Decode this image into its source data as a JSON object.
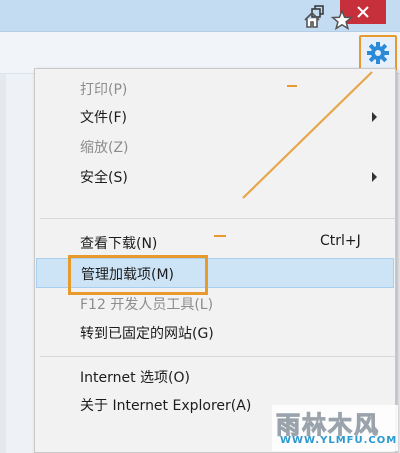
{
  "window": {
    "restore_icon": "restore-icon",
    "close_icon": "close-icon",
    "close_color": "#c7303a"
  },
  "toolbar": {
    "icons": [
      "home-icon",
      "star-icon",
      "gear-icon"
    ],
    "gear_color": "#2a8ad8",
    "highlight_color": "#e89a2c"
  },
  "menu": {
    "items": [
      {
        "label": "打印(P)",
        "enabled": false,
        "submenu": false
      },
      {
        "label": "文件(F)",
        "enabled": true,
        "submenu": true
      },
      {
        "label": "缩放(Z)",
        "enabled": false,
        "submenu": false
      },
      {
        "label": "安全(S)",
        "enabled": true,
        "submenu": true
      },
      {
        "label": "查看下载(N)",
        "enabled": true,
        "shortcut": "Ctrl+J"
      },
      {
        "label": "管理加载项(M)",
        "enabled": true,
        "highlighted": true
      },
      {
        "label": "F12 开发人员工具(L)",
        "enabled": false
      },
      {
        "label": "转到已固定的网站(G)",
        "enabled": true
      },
      {
        "label": "Internet 选项(O)",
        "enabled": true
      },
      {
        "label": "关于 Internet Explorer(A)",
        "enabled": true
      }
    ]
  },
  "watermark": {
    "name": "雨林木风",
    "url": "WWW.YLMFU.COM"
  }
}
